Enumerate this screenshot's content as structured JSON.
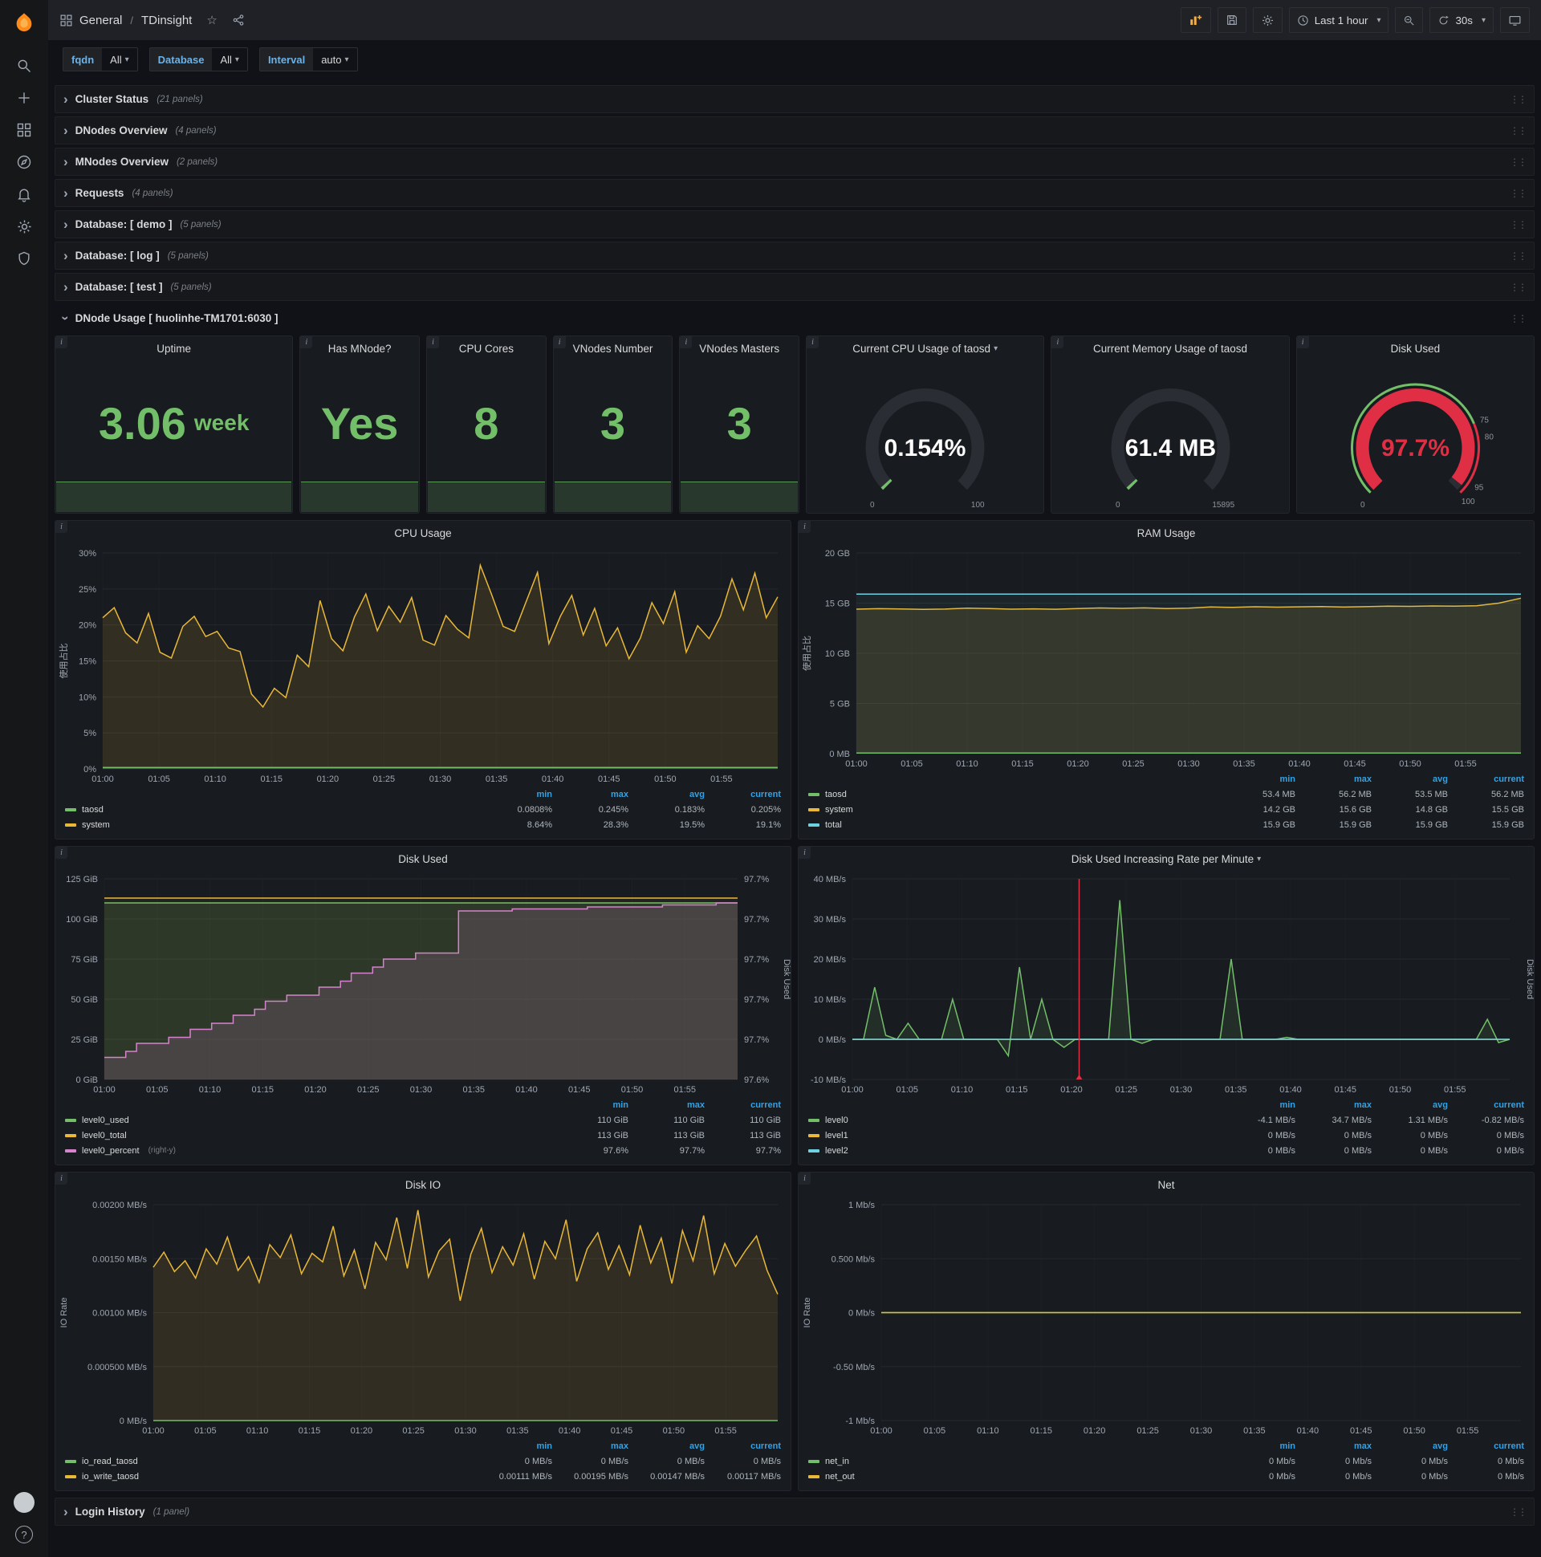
{
  "icons": {
    "caret_down": "▾",
    "chevron_right": "›",
    "drag_handle": "⋮⋮",
    "info": "i",
    "star": "☆",
    "plus": "+",
    "question": "?"
  },
  "topnav": {
    "breadcrumb_section": "General",
    "breadcrumb_sep": "/",
    "breadcrumb_title": "TDinsight",
    "time_range": "Last 1 hour",
    "refresh_interval": "30s"
  },
  "variables": [
    {
      "label": "fqdn",
      "value": "All"
    },
    {
      "label": "Database",
      "value": "All"
    },
    {
      "label": "Interval",
      "value": "auto"
    }
  ],
  "rows_collapsed": [
    {
      "title": "Cluster Status",
      "count": "(21 panels)"
    },
    {
      "title": "DNodes Overview",
      "count": "(4 panels)"
    },
    {
      "title": "MNodes Overview",
      "count": "(2 panels)"
    },
    {
      "title": "Requests",
      "count": "(4 panels)"
    },
    {
      "title": "Database: [ demo ]",
      "count": "(5 panels)"
    },
    {
      "title": "Database: [ log ]",
      "count": "(5 panels)"
    },
    {
      "title": "Database: [ test ]",
      "count": "(5 panels)"
    }
  ],
  "expanded_row": {
    "title": "DNode Usage [ huolinhe-TM1701:6030 ]"
  },
  "bottom_row": {
    "title": "Login History",
    "count": "(1 panel)"
  },
  "stats": [
    {
      "title": "Uptime",
      "value": "3.06",
      "unit": "week"
    },
    {
      "title": "Has MNode?",
      "value": "Yes"
    },
    {
      "title": "CPU Cores",
      "value": "8"
    },
    {
      "title": "VNodes Number",
      "value": "3"
    },
    {
      "title": "VNodes Masters",
      "value": "3"
    }
  ],
  "gauges": [
    {
      "title": "Current CPU Usage of taosd",
      "value": 0.154,
      "display": "0.154%",
      "min": 0,
      "max": 100,
      "min_label": "0",
      "max_label": "100",
      "color": "#73bf69",
      "text_color": "#ffffff"
    },
    {
      "title": "Current Memory Usage of taosd",
      "value": 61.4,
      "display": "61.4 MB",
      "min": 0,
      "max": 15895,
      "min_label": "0",
      "max_label": "15895",
      "color": "#73bf69",
      "text_color": "#ffffff"
    },
    {
      "title": "Disk Used",
      "value": 97.7,
      "display": "97.7%",
      "min": 0,
      "max": 100,
      "min_label": "0",
      "color": "#e02f44",
      "text_color": "#e02f44",
      "threshold_labels": [
        {
          "label": "75",
          "value": 75
        },
        {
          "label": "80",
          "value": 80
        },
        {
          "label": "95",
          "value": 95
        },
        {
          "label": "100",
          "value": 100
        }
      ],
      "outer_bands": [
        {
          "from": 0,
          "to": 75,
          "color": "#73bf69"
        },
        {
          "from": 75,
          "to": 100,
          "color": "#e02f44"
        }
      ]
    }
  ],
  "chart_data": [
    {
      "id": "cpu-usage",
      "type": "area",
      "title": "CPU Usage",
      "ylabel": "使用占比",
      "y_min": 0,
      "y_max": 30,
      "y_ticks": [
        "0%",
        "5%",
        "10%",
        "15%",
        "20%",
        "25%",
        "30%"
      ],
      "x_ticks": [
        "01:00",
        "01:05",
        "01:10",
        "01:15",
        "01:20",
        "01:25",
        "01:30",
        "01:35",
        "01:40",
        "01:45",
        "01:50",
        "01:55"
      ],
      "x_tick_step_minutes": 5,
      "x_total_minutes": 60,
      "series": [
        {
          "name": "system",
          "color": "#eab839",
          "fill": 0.13,
          "values": [
            21.0,
            22.4,
            18.9,
            17.5,
            21.6,
            16.2,
            15.4,
            19.8,
            21.2,
            18.4,
            19.1,
            16.8,
            16.3,
            10.4,
            8.6,
            11.2,
            9.9,
            15.8,
            14.2,
            23.4,
            18.1,
            16.4,
            21.1,
            24.3,
            19.2,
            22.6,
            20.4,
            23.8,
            17.9,
            17.2,
            21.3,
            19.4,
            18.2,
            28.3,
            24.2,
            19.8,
            19.1,
            23.2,
            27.3,
            17.4,
            21.2,
            24.1,
            18.6,
            22.3,
            17.1,
            19.6,
            15.3,
            18.2,
            23.1,
            20.2,
            24.6,
            16.2,
            19.9,
            18.1,
            21.2,
            26.4,
            22.1,
            27.2,
            21.0,
            23.9
          ]
        },
        {
          "name": "taosd",
          "color": "#73bf69",
          "fill": 0.35,
          "values": [
            0.2,
            0.2
          ]
        }
      ],
      "legend_cols": [
        "min",
        "max",
        "avg",
        "current"
      ],
      "legend_rows": [
        {
          "name": "taosd",
          "color": "#73bf69",
          "values": [
            "0.0808%",
            "0.245%",
            "0.183%",
            "0.205%"
          ]
        },
        {
          "name": "system",
          "color": "#eab839",
          "values": [
            "8.64%",
            "28.3%",
            "19.5%",
            "19.1%"
          ]
        }
      ]
    },
    {
      "id": "ram-usage",
      "type": "area",
      "title": "RAM Usage",
      "ylabel": "使用占比",
      "y_min": 0,
      "y_max": 20,
      "y_ticks": [
        "0 MB",
        "5 GB",
        "10 GB",
        "15 GB",
        "20 GB"
      ],
      "x_ticks": [
        "01:00",
        "01:05",
        "01:10",
        "01:15",
        "01:20",
        "01:25",
        "01:30",
        "01:35",
        "01:40",
        "01:45",
        "01:50",
        "01:55"
      ],
      "x_tick_step_minutes": 5,
      "x_total_minutes": 60,
      "series": [
        {
          "name": "system",
          "color": "#eab839",
          "fill": 0.13,
          "values": [
            14.4,
            14.45,
            14.42,
            14.38,
            14.41,
            14.5,
            14.46,
            14.4,
            14.43,
            14.39,
            14.46,
            14.52,
            14.48,
            14.53,
            14.46,
            14.5,
            14.62,
            14.58,
            14.64,
            14.6,
            14.63,
            14.66,
            14.61,
            14.65,
            14.7,
            14.68,
            14.72,
            14.7,
            14.74,
            15.0,
            15.5
          ]
        },
        {
          "name": "total",
          "color": "#6ed0e0",
          "fill": 0.06,
          "values": [
            15.9,
            15.9
          ]
        },
        {
          "name": "taosd",
          "color": "#73bf69",
          "fill": 0.35,
          "values": [
            0.053,
            0.053
          ]
        }
      ],
      "legend_cols": [
        "min",
        "max",
        "avg",
        "current"
      ],
      "legend_rows": [
        {
          "name": "taosd",
          "color": "#73bf69",
          "values": [
            "53.4 MB",
            "56.2 MB",
            "53.5 MB",
            "56.2 MB"
          ]
        },
        {
          "name": "system",
          "color": "#eab839",
          "values": [
            "14.2 GB",
            "15.6 GB",
            "14.8 GB",
            "15.5 GB"
          ]
        },
        {
          "name": "total",
          "color": "#6ed0e0",
          "values": [
            "15.9 GB",
            "15.9 GB",
            "15.9 GB",
            "15.9 GB"
          ]
        }
      ]
    },
    {
      "id": "disk-used",
      "type": "area",
      "title": "Disk Used",
      "y_min": 0,
      "y_max": 125,
      "y_ticks": [
        "0 GiB",
        "25 GiB",
        "50 GiB",
        "75 GiB",
        "100 GiB",
        "125 GiB"
      ],
      "right_min": 97.62,
      "right_max": 97.72,
      "right_ticks": [
        "97.6%",
        "97.7%",
        "97.7%",
        "97.7%",
        "97.7%",
        "97.7%"
      ],
      "right_label": "Disk Used",
      "x_ticks": [
        "01:00",
        "01:05",
        "01:10",
        "01:15",
        "01:20",
        "01:25",
        "01:30",
        "01:35",
        "01:40",
        "01:45",
        "01:50",
        "01:55"
      ],
      "x_tick_step_minutes": 5,
      "x_total_minutes": 60,
      "series": [
        {
          "name": "level0_used",
          "color": "#73bf69",
          "fill": 0.14,
          "values": [
            110,
            110
          ]
        },
        {
          "name": "level0_total",
          "color": "#eab839",
          "fill": 0.05,
          "values": [
            113,
            113
          ]
        },
        {
          "name": "level0_percent",
          "color": "#d683ce",
          "fill": 0.16,
          "axis": "right",
          "step": true,
          "values": [
            97.631,
            97.631,
            97.634,
            97.638,
            97.638,
            97.638,
            97.641,
            97.641,
            97.645,
            97.645,
            97.648,
            97.648,
            97.652,
            97.652,
            97.655,
            97.659,
            97.659,
            97.662,
            97.662,
            97.662,
            97.666,
            97.666,
            97.669,
            97.673,
            97.673,
            97.676,
            97.68,
            97.68,
            97.68,
            97.683,
            97.683,
            97.683,
            97.683,
            97.704,
            97.704,
            97.704,
            97.704,
            97.704,
            97.705,
            97.705,
            97.705,
            97.705,
            97.705,
            97.705,
            97.705,
            97.706,
            97.706,
            97.706,
            97.706,
            97.706,
            97.706,
            97.706,
            97.707,
            97.707,
            97.707,
            97.707,
            97.707,
            97.708,
            97.708,
            97.708
          ]
        }
      ],
      "legend_cols": [
        "min",
        "max",
        "current"
      ],
      "legend_rows": [
        {
          "name": "level0_used",
          "color": "#73bf69",
          "values": [
            "110 GiB",
            "110 GiB",
            "110 GiB"
          ]
        },
        {
          "name": "level0_total",
          "color": "#eab839",
          "values": [
            "113 GiB",
            "113 GiB",
            "113 GiB"
          ]
        },
        {
          "name": "level0_percent",
          "suffix": "(right-y)",
          "color": "#d683ce",
          "values": [
            "97.6%",
            "97.7%",
            "97.7%"
          ]
        }
      ]
    },
    {
      "id": "disk-rate",
      "type": "area",
      "title": "Disk Used Increasing Rate per Minute",
      "dropdown": true,
      "y_min": -10,
      "y_max": 40,
      "y_ticks": [
        "-10 MB/s",
        "0 MB/s",
        "10 MB/s",
        "20 MB/s",
        "30 MB/s",
        "40 MB/s"
      ],
      "right_label": "Disk Used",
      "annotation_x": 0.345,
      "x_ticks": [
        "01:00",
        "01:05",
        "01:10",
        "01:15",
        "01:20",
        "01:25",
        "01:30",
        "01:35",
        "01:40",
        "01:45",
        "01:50",
        "01:55"
      ],
      "x_tick_step_minutes": 5,
      "x_total_minutes": 60,
      "series": [
        {
          "name": "level0",
          "color": "#73bf69",
          "fill": 0.12,
          "values": [
            0,
            0,
            13,
            1,
            0,
            4,
            0,
            0,
            0,
            10,
            0,
            0,
            0,
            0,
            -4.1,
            18,
            0,
            10,
            0,
            -2,
            0,
            0,
            0,
            0,
            34.7,
            0,
            -1,
            0,
            0,
            0,
            0,
            0,
            0,
            0,
            20,
            0,
            0,
            0,
            0,
            0.5,
            0,
            0,
            0,
            0,
            0,
            0,
            0,
            0,
            0,
            0,
            0,
            0,
            0,
            0,
            0,
            0,
            0,
            5,
            -0.82,
            0
          ]
        },
        {
          "name": "level1",
          "color": "#eab839",
          "values": [
            0,
            0
          ]
        },
        {
          "name": "level2",
          "color": "#6ed0e0",
          "values": [
            0,
            0
          ]
        }
      ],
      "legend_cols": [
        "min",
        "max",
        "avg",
        "current"
      ],
      "legend_rows": [
        {
          "name": "level0",
          "color": "#73bf69",
          "values": [
            "-4.1 MB/s",
            "34.7 MB/s",
            "1.31 MB/s",
            "-0.82 MB/s"
          ]
        },
        {
          "name": "level1",
          "color": "#eab839",
          "values": [
            "0 MB/s",
            "0 MB/s",
            "0 MB/s",
            "0 MB/s"
          ]
        },
        {
          "name": "level2",
          "color": "#6ed0e0",
          "values": [
            "0 MB/s",
            "0 MB/s",
            "0 MB/s",
            "0 MB/s"
          ]
        }
      ]
    },
    {
      "id": "disk-io",
      "type": "area",
      "title": "Disk IO",
      "ylabel": "IO Rate",
      "y_min": 0,
      "y_max": 0.002,
      "y_ticks": [
        "0 MB/s",
        "0.000500 MB/s",
        "0.00100 MB/s",
        "0.00150 MB/s",
        "0.00200 MB/s"
      ],
      "x_ticks": [
        "01:00",
        "01:05",
        "01:10",
        "01:15",
        "01:20",
        "01:25",
        "01:30",
        "01:35",
        "01:40",
        "01:45",
        "01:50",
        "01:55"
      ],
      "x_tick_step_minutes": 5,
      "x_total_minutes": 60,
      "series": [
        {
          "name": "io_write_taosd",
          "color": "#eab839",
          "fill": 0.12,
          "values": [
            0.00142,
            0.00156,
            0.00138,
            0.00148,
            0.00132,
            0.00159,
            0.00145,
            0.0017,
            0.00139,
            0.00152,
            0.00128,
            0.00163,
            0.00151,
            0.00172,
            0.00136,
            0.00155,
            0.00147,
            0.0018,
            0.00134,
            0.00158,
            0.00122,
            0.00165,
            0.00149,
            0.00188,
            0.00141,
            0.00195,
            0.00133,
            0.00157,
            0.00168,
            0.00111,
            0.00154,
            0.00178,
            0.00137,
            0.00161,
            0.00144,
            0.00173,
            0.00131,
            0.00166,
            0.0015,
            0.00186,
            0.00129,
            0.00159,
            0.00174,
            0.0014,
            0.00162,
            0.00135,
            0.00181,
            0.00146,
            0.00169,
            0.00127,
            0.00176,
            0.00148,
            0.0019,
            0.00136,
            0.00164,
            0.00143,
            0.00158,
            0.00171,
            0.00139,
            0.00117
          ]
        },
        {
          "name": "io_read_taosd",
          "color": "#73bf69",
          "values": [
            0,
            0
          ]
        }
      ],
      "legend_cols": [
        "min",
        "max",
        "avg",
        "current"
      ],
      "legend_rows": [
        {
          "name": "io_read_taosd",
          "color": "#73bf69",
          "values": [
            "0 MB/s",
            "0 MB/s",
            "0 MB/s",
            "0 MB/s"
          ]
        },
        {
          "name": "io_write_taosd",
          "color": "#eab839",
          "values": [
            "0.00111 MB/s",
            "0.00195 MB/s",
            "0.00147 MB/s",
            "0.00117 MB/s"
          ]
        }
      ]
    },
    {
      "id": "net",
      "type": "line",
      "title": "Net",
      "ylabel": "IO Rate",
      "y_min": -1,
      "y_max": 1,
      "y_ticks": [
        "-1 Mb/s",
        "-0.50 Mb/s",
        "0 Mb/s",
        "0.500 Mb/s",
        "1 Mb/s"
      ],
      "x_ticks": [
        "01:00",
        "01:05",
        "01:10",
        "01:15",
        "01:20",
        "01:25",
        "01:30",
        "01:35",
        "01:40",
        "01:45",
        "01:50",
        "01:55"
      ],
      "x_tick_step_minutes": 5,
      "x_total_minutes": 60,
      "series": [
        {
          "name": "net_in",
          "color": "#73bf69",
          "values": [
            0,
            0
          ]
        },
        {
          "name": "net_out",
          "color": "#eab839",
          "values": [
            0,
            0
          ]
        }
      ],
      "legend_cols": [
        "min",
        "max",
        "avg",
        "current"
      ],
      "legend_rows": [
        {
          "name": "net_in",
          "color": "#73bf69",
          "values": [
            "0 Mb/s",
            "0 Mb/s",
            "0 Mb/s",
            "0 Mb/s"
          ]
        },
        {
          "name": "net_out",
          "color": "#eab839",
          "values": [
            "0 Mb/s",
            "0 Mb/s",
            "0 Mb/s",
            "0 Mb/s"
          ]
        }
      ]
    }
  ]
}
